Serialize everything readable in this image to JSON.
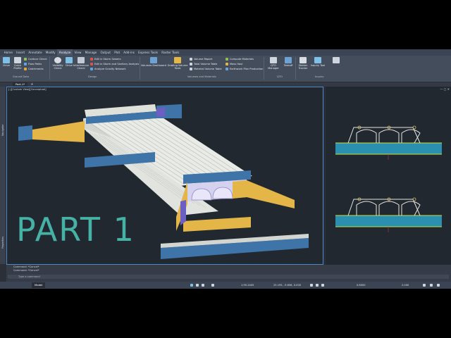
{
  "ribbon_tabs": [
    {
      "label": "Home"
    },
    {
      "label": "Insert"
    },
    {
      "label": "Annotate"
    },
    {
      "label": "Modify"
    },
    {
      "label": "Analyze",
      "active": true
    },
    {
      "label": "View"
    },
    {
      "label": "Manage"
    },
    {
      "label": "Output"
    },
    {
      "label": "Plot"
    },
    {
      "label": "Add-ins"
    },
    {
      "label": "Express Tools"
    },
    {
      "label": "Raster Tools"
    }
  ],
  "ribbon": {
    "ground_data": {
      "drive_label": "Drive",
      "quick_profile_label": "Quick Profile",
      "contour_check": "Contour Check",
      "flow_paths": "Flow Paths",
      "catchments": "Catchments",
      "group_label": "Ground Data"
    },
    "design": {
      "visibility_check": "Visibility Check",
      "drive": "Drive",
      "interference_check": "Interference Check",
      "storm_sewers": "Edit in Storm Sewers",
      "storm_sanitary": "Edit in Storm and Sanitary Analysis",
      "gravity_network": "Analyze Gravity Network",
      "group_label": "Design"
    },
    "volumes": {
      "volumes_dashboard": "Volumes Dashboard",
      "grading_volume_tools": "Grading Volume Tools",
      "volume_report": "Volume Report",
      "total_volume_table": "Total Volume Table",
      "material_volume_table": "Material Volume Table",
      "compute_materials": "Compute Materials",
      "mass_haul": "Mass Haul",
      "earthwork_plan": "Earthwork Plan Production",
      "group_label": "Volumes and Materials"
    },
    "qto": {
      "qto_manager": "QTO Manager",
      "takeoff": "Takeoff",
      "group_label": "QTO"
    },
    "inquiry": {
      "station_tracker": "Station Tracker",
      "inquiry_tool": "Inquiry Tool",
      "group_label": "Inquiry"
    }
  },
  "doc_tab": "Part-1*",
  "palettes": {
    "left_top": "Navigator",
    "left_bottom": "Properties"
  },
  "viewport_label": "[-][Custom View][Conceptual]",
  "overlay_text": "PART 1",
  "command": {
    "history": [
      "Command: *Cancel*",
      "Command: *Cancel*"
    ],
    "placeholder": "Type a command"
  },
  "status": {
    "model_tab": "Model",
    "scale": "1:95.2405",
    "coords": "25.195, -9.656, 0.000",
    "zoom_pct": "0.8000",
    "view_scale": "2.000"
  },
  "colors": {
    "ui_dark": "#2b3038",
    "ribbon": "#444d5c",
    "accent": "#4d89c4",
    "overlay_text": "#46b2a6",
    "slab": "#e9ebe6",
    "wing": "#e4b547",
    "wall": "#3e74a8"
  }
}
